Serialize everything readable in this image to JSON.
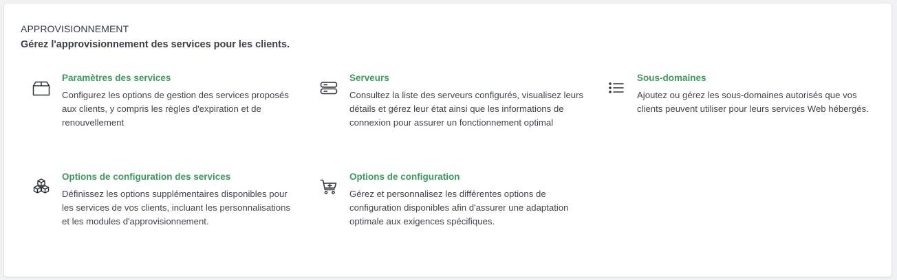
{
  "section": {
    "title": "APPROVISIONNEMENT",
    "subtitle": "Gérez l'approvisionnement des services pour les clients."
  },
  "colors": {
    "link": "#3a9b5c",
    "text": "#3f464d",
    "heading": "#333a42"
  },
  "items": [
    {
      "icon": "box-icon",
      "title": "Paramètres des services",
      "description": "Configurez les options de gestion des services proposés aux clients, y compris les règles d'expiration et de renouvellement"
    },
    {
      "icon": "server-icon",
      "title": "Serveurs",
      "description": "Consultez la liste des serveurs configurés, visualisez leurs détails et gérez leur état ainsi que les informations de connexion pour assurer un fonctionnement optimal"
    },
    {
      "icon": "list-icon",
      "title": "Sous-domaines",
      "description": "Ajoutez ou gérez les sous-domaines autorisés que vos clients peuvent utiliser pour leurs services Web hébergés."
    },
    {
      "icon": "cubes-icon",
      "title": "Options de configuration des services",
      "description": "Définissez les options supplémentaires disponibles pour les services de vos clients, incluant les personnalisations et les modules d'approvisionnement."
    },
    {
      "icon": "cart-plus-icon",
      "title": "Options de configuration",
      "description": "Gérez et personnalisez les différentes options de configuration disponibles afin d'assurer une adaptation optimale aux exigences spécifiques."
    }
  ]
}
